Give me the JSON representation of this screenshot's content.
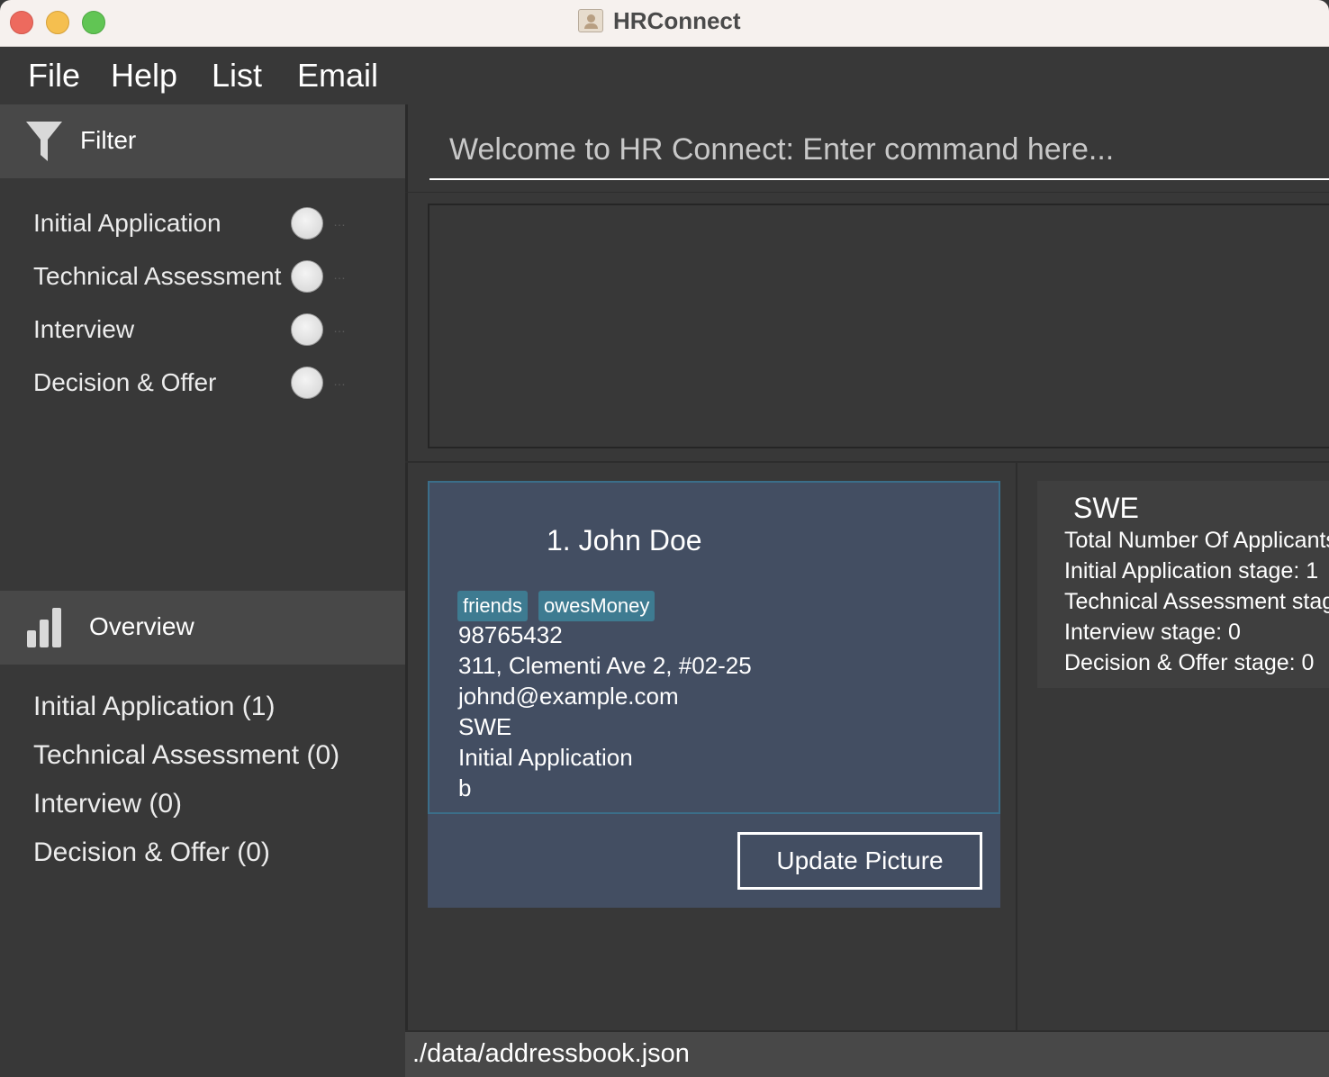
{
  "window": {
    "title": "HRConnect"
  },
  "menu": [
    "File",
    "Help",
    "List",
    "Email"
  ],
  "filter": {
    "header": "Filter",
    "items": [
      {
        "label": "Initial Application",
        "selected": false
      },
      {
        "label": "Technical Assessment",
        "selected": false
      },
      {
        "label": "Interview",
        "selected": false
      },
      {
        "label": "Decision & Offer",
        "selected": false
      }
    ]
  },
  "overview": {
    "header": "Overview",
    "items": [
      "Initial Application (1)",
      "Technical Assessment (0)",
      "Interview (0)",
      "Decision & Offer (0)"
    ]
  },
  "command": {
    "placeholder": "Welcome to HR Connect: Enter command here..."
  },
  "result": {
    "text": ""
  },
  "applicant": {
    "name": "1.  John Doe",
    "tags": [
      "friends",
      "owesMoney"
    ],
    "phone": "98765432",
    "address": "311, Clementi Ave 2, #02-25",
    "email": "johnd@example.com",
    "role": "SWE",
    "stage": "Initial Application",
    "note": "b",
    "update_button": "Update Picture"
  },
  "stats": {
    "title": "SWE",
    "lines": [
      "Total Number Of Applicants",
      "Initial Application stage: 1",
      "Technical Assessment stag",
      "Interview stage: 0",
      "Decision & Offer stage: 0"
    ]
  },
  "status": {
    "path": "./data/addressbook.json"
  }
}
